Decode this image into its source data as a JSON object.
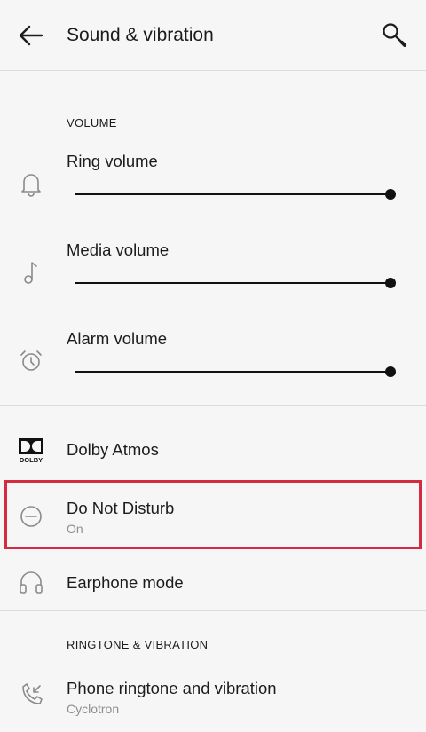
{
  "appbar": {
    "title": "Sound & vibration",
    "back_icon": "arrow-left-icon",
    "search_icon": "search-icon"
  },
  "volume_section": {
    "header": "VOLUME",
    "items": [
      {
        "label": "Ring volume",
        "icon": "bell-icon",
        "level": 1.0
      },
      {
        "label": "Media volume",
        "icon": "music-note-icon",
        "level": 1.0
      },
      {
        "label": "Alarm volume",
        "icon": "alarm-clock-icon",
        "level": 1.0
      }
    ]
  },
  "settings": {
    "dolby": {
      "label": "Dolby Atmos",
      "icon": "dolby-logo-icon",
      "logo_text": "DOLBY"
    },
    "dnd": {
      "label": "Do Not Disturb",
      "status": "On",
      "icon": "minus-circle-icon"
    },
    "earphone": {
      "label": "Earphone mode",
      "icon": "headphones-icon"
    }
  },
  "ringtone_section": {
    "header": "RINGTONE & VIBRATION",
    "items": [
      {
        "label": "Phone ringtone and vibration",
        "value": "Cyclotron",
        "icon": "phone-ringtone-icon"
      }
    ]
  },
  "colors": {
    "background": "#f6f6f6",
    "text": "#1c1c1c",
    "secondary_text": "#8e8e8e",
    "highlight_border": "#d42a42"
  }
}
